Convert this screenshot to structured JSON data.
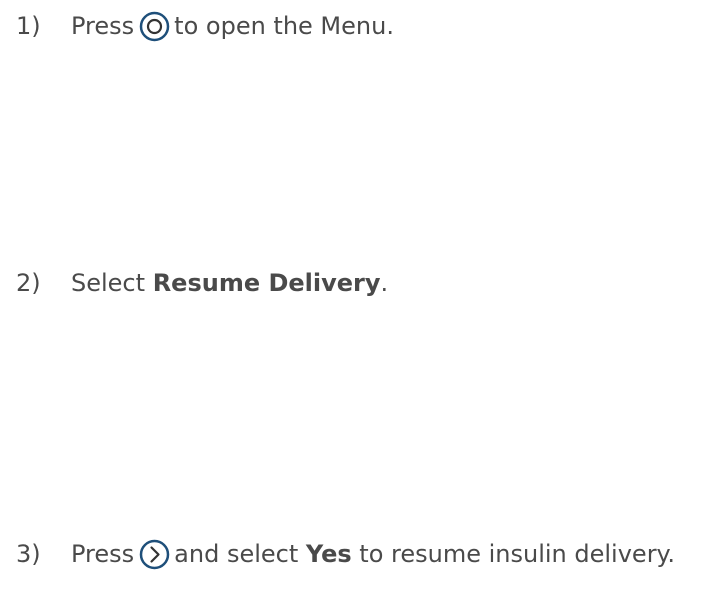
{
  "steps": [
    {
      "number": "1)",
      "before": "Press",
      "icon": "circle-button-icon",
      "after": "to open the Menu."
    },
    {
      "number": "2)",
      "before": "Select",
      "bold": "Resume Delivery",
      "after": "."
    },
    {
      "number": "3)",
      "before": "Press",
      "icon": "right-arrow-button-icon",
      "after_plain": "and select",
      "bold": "Yes",
      "after": "to resume insulin delivery."
    }
  ],
  "colors": {
    "text": "#4a4a4a",
    "icon_ring": "#1e4f7a",
    "icon_glyph": "#333333"
  }
}
